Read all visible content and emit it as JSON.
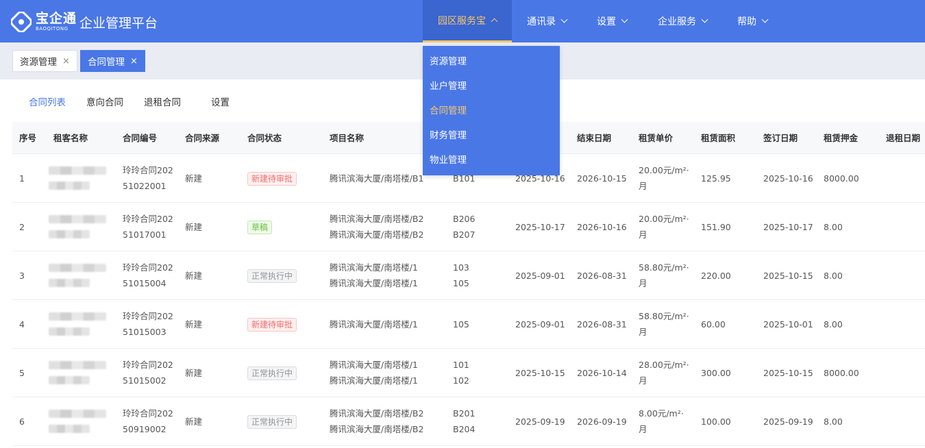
{
  "header": {
    "logo_name": "宝企通",
    "logo_sub": "BAOQITONG",
    "platform_title": "企业管理平台",
    "colors": {
      "primary": "#4a77e6",
      "active_text": "#f6c86a"
    },
    "nav": [
      {
        "label": "园区服务宝",
        "active": true,
        "icon": "chevron-up-icon"
      },
      {
        "label": "通讯录",
        "icon": "chevron-down-icon"
      },
      {
        "label": "设置",
        "icon": "chevron-down-icon"
      },
      {
        "label": "企业服务",
        "icon": "chevron-down-icon"
      },
      {
        "label": "帮助",
        "icon": "chevron-down-icon"
      }
    ]
  },
  "dropdown": {
    "items": [
      {
        "label": "资源管理"
      },
      {
        "label": "业户管理"
      },
      {
        "label": "合同管理",
        "active": true
      },
      {
        "label": "财务管理"
      },
      {
        "label": "物业管理"
      }
    ]
  },
  "tabs": [
    {
      "label": "资源管理",
      "close": "×"
    },
    {
      "label": "合同管理",
      "close": "×",
      "active": true
    }
  ],
  "subtabs": [
    {
      "label": "合同列表",
      "active": true
    },
    {
      "label": "意向合同"
    },
    {
      "label": "退租合同"
    },
    {
      "label": "设置"
    }
  ],
  "table": {
    "headers": {
      "index": "序号",
      "tenant": "租客名称",
      "contract_no": "合同编号",
      "source": "合同来源",
      "status": "合同状态",
      "project": "项目名称",
      "end_date": "结束日期",
      "unit_price": "租赁单价",
      "area": "租赁面积",
      "sign_date": "签订日期",
      "deposit": "租赁押金",
      "checkout_date": "退租日期"
    },
    "rows": [
      {
        "index": "1",
        "contract_no": [
          "玲玲合同202",
          "51022001"
        ],
        "source": "新建",
        "status": "新建待审批",
        "status_type": "pending",
        "project": [
          "腾讯滨海大厦/南塔楼/B1"
        ],
        "room": [
          "B101"
        ],
        "start_date": "2025-10-16",
        "end_date": "2026-10-15",
        "unit_price": [
          "20.00元/m²·",
          "月"
        ],
        "area": "125.95",
        "sign_date": "2025-10-16",
        "deposit": "8000.00",
        "checkout_date": ""
      },
      {
        "index": "2",
        "contract_no": [
          "玲玲合同202",
          "51017001"
        ],
        "source": "新建",
        "status": "草稿",
        "status_type": "draft",
        "project": [
          "腾讯滨海大厦/南塔楼/B2",
          "腾讯滨海大厦/南塔楼/B2"
        ],
        "room": [
          "B206",
          "B207"
        ],
        "start_date": "2025-10-17",
        "end_date": "2026-10-16",
        "unit_price": [
          "20.00元/m²·",
          "月"
        ],
        "area": "151.90",
        "sign_date": "2025-10-17",
        "deposit": "8.00",
        "checkout_date": ""
      },
      {
        "index": "3",
        "contract_no": [
          "玲玲合同202",
          "51015004"
        ],
        "source": "新建",
        "status": "正常执行中",
        "status_type": "normal",
        "project": [
          "腾讯滨海大厦/南塔楼/1",
          "腾讯滨海大厦/南塔楼/1"
        ],
        "room": [
          "103",
          "105"
        ],
        "start_date": "2025-09-01",
        "end_date": "2026-08-31",
        "unit_price": [
          "58.80元/m²·",
          "月"
        ],
        "area": "220.00",
        "sign_date": "2025-10-15",
        "deposit": "8.00",
        "checkout_date": ""
      },
      {
        "index": "4",
        "contract_no": [
          "玲玲合同202",
          "51015003"
        ],
        "source": "新建",
        "status": "新建待审批",
        "status_type": "pending",
        "project": [
          "腾讯滨海大厦/南塔楼/1"
        ],
        "room": [
          "105"
        ],
        "start_date": "2025-09-01",
        "end_date": "2026-08-31",
        "unit_price": [
          "58.80元/m²·",
          "月"
        ],
        "area": "60.00",
        "sign_date": "2025-10-01",
        "deposit": "8.00",
        "checkout_date": ""
      },
      {
        "index": "5",
        "contract_no": [
          "玲玲合同202",
          "51015002"
        ],
        "source": "新建",
        "status": "正常执行中",
        "status_type": "normal",
        "project": [
          "腾讯滨海大厦/南塔楼/1",
          "腾讯滨海大厦/南塔楼/1"
        ],
        "room": [
          "101",
          "102"
        ],
        "start_date": "2025-10-15",
        "end_date": "2026-10-14",
        "unit_price": [
          "28.00元/m²·",
          "月"
        ],
        "area": "300.00",
        "sign_date": "2025-10-15",
        "deposit": "8000.00",
        "checkout_date": ""
      },
      {
        "index": "6",
        "contract_no": [
          "玲玲合同202",
          "50919002"
        ],
        "source": "新建",
        "status": "正常执行中",
        "status_type": "normal",
        "project": [
          "腾讯滨海大厦/南塔楼/B2",
          "腾讯滨海大厦/南塔楼/B2"
        ],
        "room": [
          "B201",
          "B204"
        ],
        "start_date": "2025-09-19",
        "end_date": "2026-09-19",
        "unit_price": [
          "8.00元/m²·",
          "月"
        ],
        "area": "100.00",
        "sign_date": "2025-09-19",
        "deposit": "8.00",
        "checkout_date": ""
      }
    ]
  }
}
